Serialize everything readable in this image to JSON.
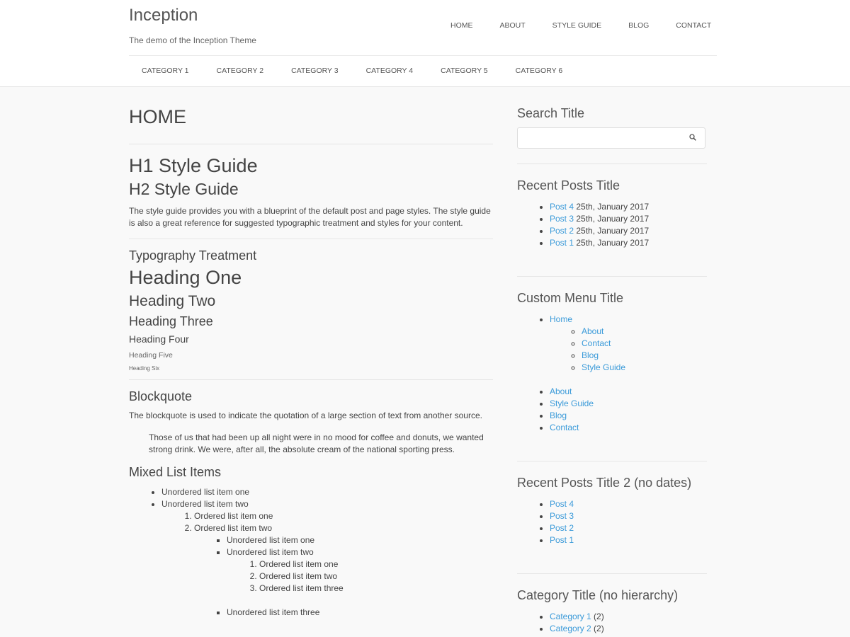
{
  "site": {
    "title": "Inception",
    "description": "The demo of the Inception Theme"
  },
  "main_nav": [
    "HOME",
    "ABOUT",
    "STYLE GUIDE",
    "BLOG",
    "CONTACT"
  ],
  "category_nav": [
    "CATEGORY 1",
    "CATEGORY 2",
    "CATEGORY 3",
    "CATEGORY 4",
    "CATEGORY 5",
    "CATEGORY 6"
  ],
  "content": {
    "page_title": "HOME",
    "h1": "H1 Style Guide",
    "h2": "H2 Style Guide",
    "intro": "The style guide provides you with a blueprint of the default post and page styles. The style guide is also a great reference for suggested typographic treatment and styles for your content.",
    "typography_title": "Typography Treatment",
    "headings": [
      "Heading One",
      "Heading Two",
      "Heading Three",
      "Heading Four",
      "Heading Five",
      "Heading Six"
    ],
    "blockquote_title": "Blockquote",
    "blockquote_intro": "The blockquote is used to indicate the quotation of a large section of text from another source.",
    "blockquote_text": "Those of us that had been up all night were in no mood for coffee and donuts, we wanted strong drink. We were, after all, the absolute cream of the national sporting press.",
    "mixed_title": "Mixed List Items",
    "list": {
      "ul1": "Unordered list item one",
      "ul2": "Unordered list item two",
      "ol1": "Ordered list item one",
      "ol2": "Ordered list item two",
      "ul2_1": "Unordered list item one",
      "ul2_2": "Unordered list item two",
      "ol2_1": "Ordered list item one",
      "ol2_2": "Ordered list item two",
      "ol2_3": "Ordered list item three",
      "ul2_3": "Unordered list item three"
    }
  },
  "sidebar": {
    "search_title": "Search Title",
    "recent_title": "Recent Posts Title",
    "recent_posts": [
      {
        "link": "Post 4",
        "date": "25th, January 2017"
      },
      {
        "link": "Post 3",
        "date": "25th, January 2017"
      },
      {
        "link": "Post 2",
        "date": "25th, January 2017"
      },
      {
        "link": "Post 1",
        "date": "25th, January 2017"
      }
    ],
    "custom_menu_title": "Custom Menu Title",
    "custom_menu_home": "Home",
    "custom_menu_sub": [
      "About",
      "Contact",
      "Blog",
      "Style Guide"
    ],
    "custom_menu_more": [
      "About",
      "Style Guide",
      "Blog",
      "Contact"
    ],
    "recent2_title": "Recent Posts Title 2 (no dates)",
    "recent2_posts": [
      "Post 4",
      "Post 3",
      "Post 2",
      "Post 1"
    ],
    "category_title": "Category Title (no hierarchy)",
    "categories": [
      {
        "link": "Category 1",
        "count": "(2)"
      },
      {
        "link": "Category 2",
        "count": "(2)"
      }
    ]
  }
}
